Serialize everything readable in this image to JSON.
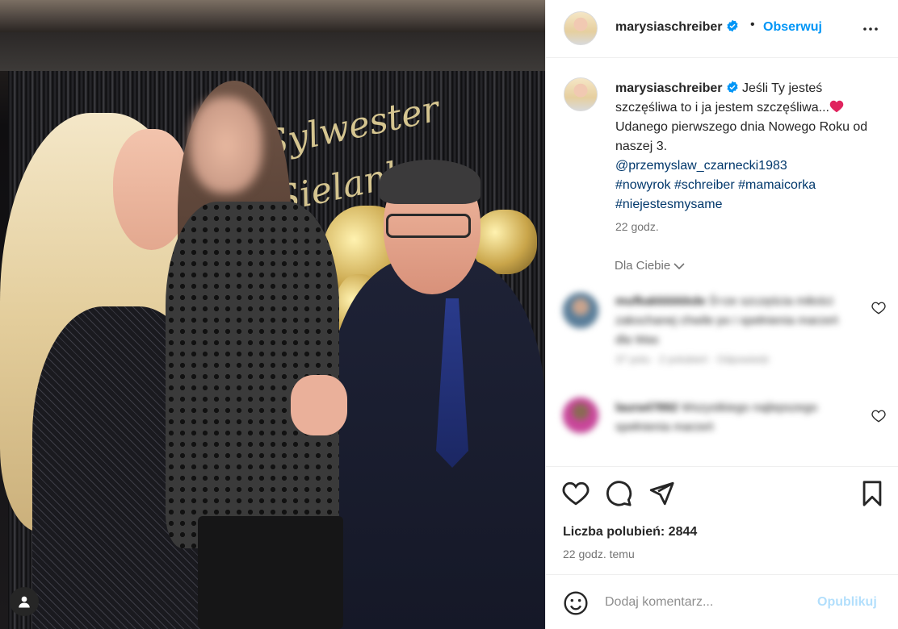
{
  "post": {
    "username": "marysiaschreiber",
    "dot": "•",
    "follow_label": "Obserwuj",
    "caption": {
      "username": "marysiaschreiber",
      "text_line1": "Jeśli Ty jesteś szczęśliwa to i ja jestem szczęśliwa...",
      "text_line2": "Udanego pierwszego dnia Nowego Roku od naszej 3.",
      "mention": "@przemyslaw_czarnecki1983",
      "hashtags": [
        "#nowyrok",
        "#schreiber",
        "#mamaicorka",
        "#niejestesmysame"
      ],
      "time": "22 godz."
    },
    "comments_filter": "Dla Ciebie",
    "comments": [
      {
        "username": "mufkakkkkkkde",
        "text": "Ś=ze szczęścia miłości zakochanej chwile po i spełnienia marzeń dla Was",
        "meta": "37 polu · 2 polubień · Odpowiedz"
      },
      {
        "username": "laura47892",
        "text": "Wszystkiego najlepszego spełnienia marzeń",
        "meta": ""
      }
    ],
    "likes_label": "Liczba polubień: 2844",
    "time_ago": "22 godz. temu",
    "comment_placeholder": "Dodaj komentarz...",
    "publish_label": "Opublikuj"
  },
  "photo": {
    "banner_script_line1": "Sylwester",
    "banner_script_line2": "Sielanka"
  },
  "colors": {
    "link": "#00376b",
    "follow": "#0095f6",
    "verified": "#0095f6",
    "muted": "#737373",
    "publish_disabled": "#b2dffc",
    "heart": "#e0245e"
  },
  "icons": {
    "header_more": "more-horizontal-icon",
    "verified": "verified-badge-icon",
    "like": "heart-icon",
    "comment": "comment-bubble-icon",
    "share": "paper-plane-icon",
    "save": "bookmark-icon",
    "emoji": "smiley-icon",
    "tag": "user-tag-icon"
  }
}
